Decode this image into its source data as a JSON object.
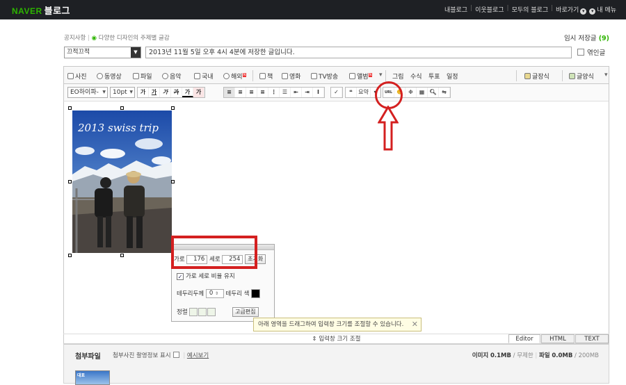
{
  "header": {
    "logo_brand": "NAVER",
    "logo_service": "블로그",
    "nav": [
      "내블로그",
      "이웃블로그",
      "모두의 블로그",
      "바로가기",
      "내 메뉴"
    ]
  },
  "notice": {
    "label": "공지사항",
    "text": "다양한 디자인의 주제별 글감"
  },
  "draft": {
    "label": "임시 저장글",
    "count": "(9)"
  },
  "post": {
    "category": "끄적끄적",
    "title_value": "2013년 11월 5일 오후 4시 4분에 저장한 글입니다.",
    "public_label": "엮인글"
  },
  "toolbar_insert": [
    {
      "label": "사진",
      "icon": "photo-icon"
    },
    {
      "label": "동영상",
      "icon": "video-icon"
    },
    {
      "label": "파일",
      "icon": "file-icon"
    },
    {
      "label": "음악",
      "icon": "music-icon"
    },
    {
      "label": "국내",
      "icon": "domestic-map-icon"
    },
    {
      "label": "해외",
      "icon": "globe-icon"
    },
    {
      "label": "책",
      "icon": "book-icon"
    },
    {
      "label": "영화",
      "icon": "movie-icon"
    },
    {
      "label": "TV방송",
      "icon": "tv-icon"
    },
    {
      "label": "앨범",
      "icon": "album-icon"
    },
    {
      "label": "그림",
      "icon": ""
    },
    {
      "label": "수식",
      "icon": ""
    },
    {
      "label": "투표",
      "icon": ""
    },
    {
      "label": "일정",
      "icon": ""
    }
  ],
  "toolbar_right": {
    "template": "글장식",
    "layout": "글양식"
  },
  "format": {
    "font": "EO하이파-",
    "size": "10pt",
    "quote": "요약"
  },
  "image": {
    "title_text": "2013 swiss trip"
  },
  "resize_popup": {
    "width_label": "가로",
    "width_value": "176",
    "height_label": "세로",
    "height_value": "254",
    "reset_button": "초기화",
    "keep_ratio_label": "가로 세로 비율 유지",
    "border_width_label": "테두리두께",
    "border_width_value": "0",
    "border_color_label": "테두리 색",
    "align_label": "정렬",
    "advanced_button": "고급편집"
  },
  "tooltip": {
    "text": "아래 영역을 드래그하여 입력창 크기를 조절할 수 있습니다."
  },
  "resize_bar": {
    "text": "입력창 크기 조절"
  },
  "mode_tabs": [
    "Editor",
    "HTML",
    "TEXT"
  ],
  "attachments": {
    "label": "첨부파일",
    "option_label": "첨부사진 촬영정보 표시",
    "preview_link": "예시보기",
    "image_label": "이미지",
    "image_size": "0.1MB",
    "image_limit": "무제한",
    "file_label": "파일",
    "file_size": "0.0MB",
    "file_limit": "200MB",
    "thumb_text": "대표"
  },
  "colors": {
    "naver_green": "#2db400",
    "annotation_red": "#d42020",
    "topbar": "#1e2024"
  }
}
